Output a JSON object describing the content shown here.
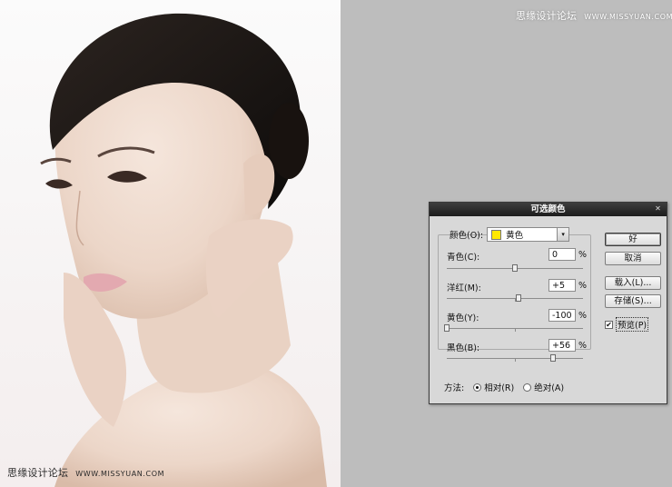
{
  "dialog": {
    "title": "可选颜色",
    "color_label": "颜色(O):",
    "color_value": "黄色",
    "color_swatch": "#ffe800",
    "sliders": [
      {
        "label": "青色(C):",
        "value": "0",
        "unit": "%",
        "position": 0.5
      },
      {
        "label": "洋红(M):",
        "value": "+5",
        "unit": "%",
        "position": 0.525
      },
      {
        "label": "黄色(Y):",
        "value": "-100",
        "unit": "%",
        "position": 0.0
      },
      {
        "label": "黑色(B):",
        "value": "+56",
        "unit": "%",
        "position": 0.78
      }
    ],
    "method_label": "方法:",
    "method_options": [
      "相对(R)",
      "绝对(A)"
    ],
    "method_selected": "相对(R)",
    "buttons": {
      "ok": "好",
      "cancel": "取消",
      "load": "载入(L)...",
      "save": "存储(S)..."
    },
    "preview_label": "预览(P)",
    "preview_checked": true
  },
  "watermark": {
    "site_name": "思缘设计论坛",
    "url": "WWW.MISSYUAN.COM"
  }
}
